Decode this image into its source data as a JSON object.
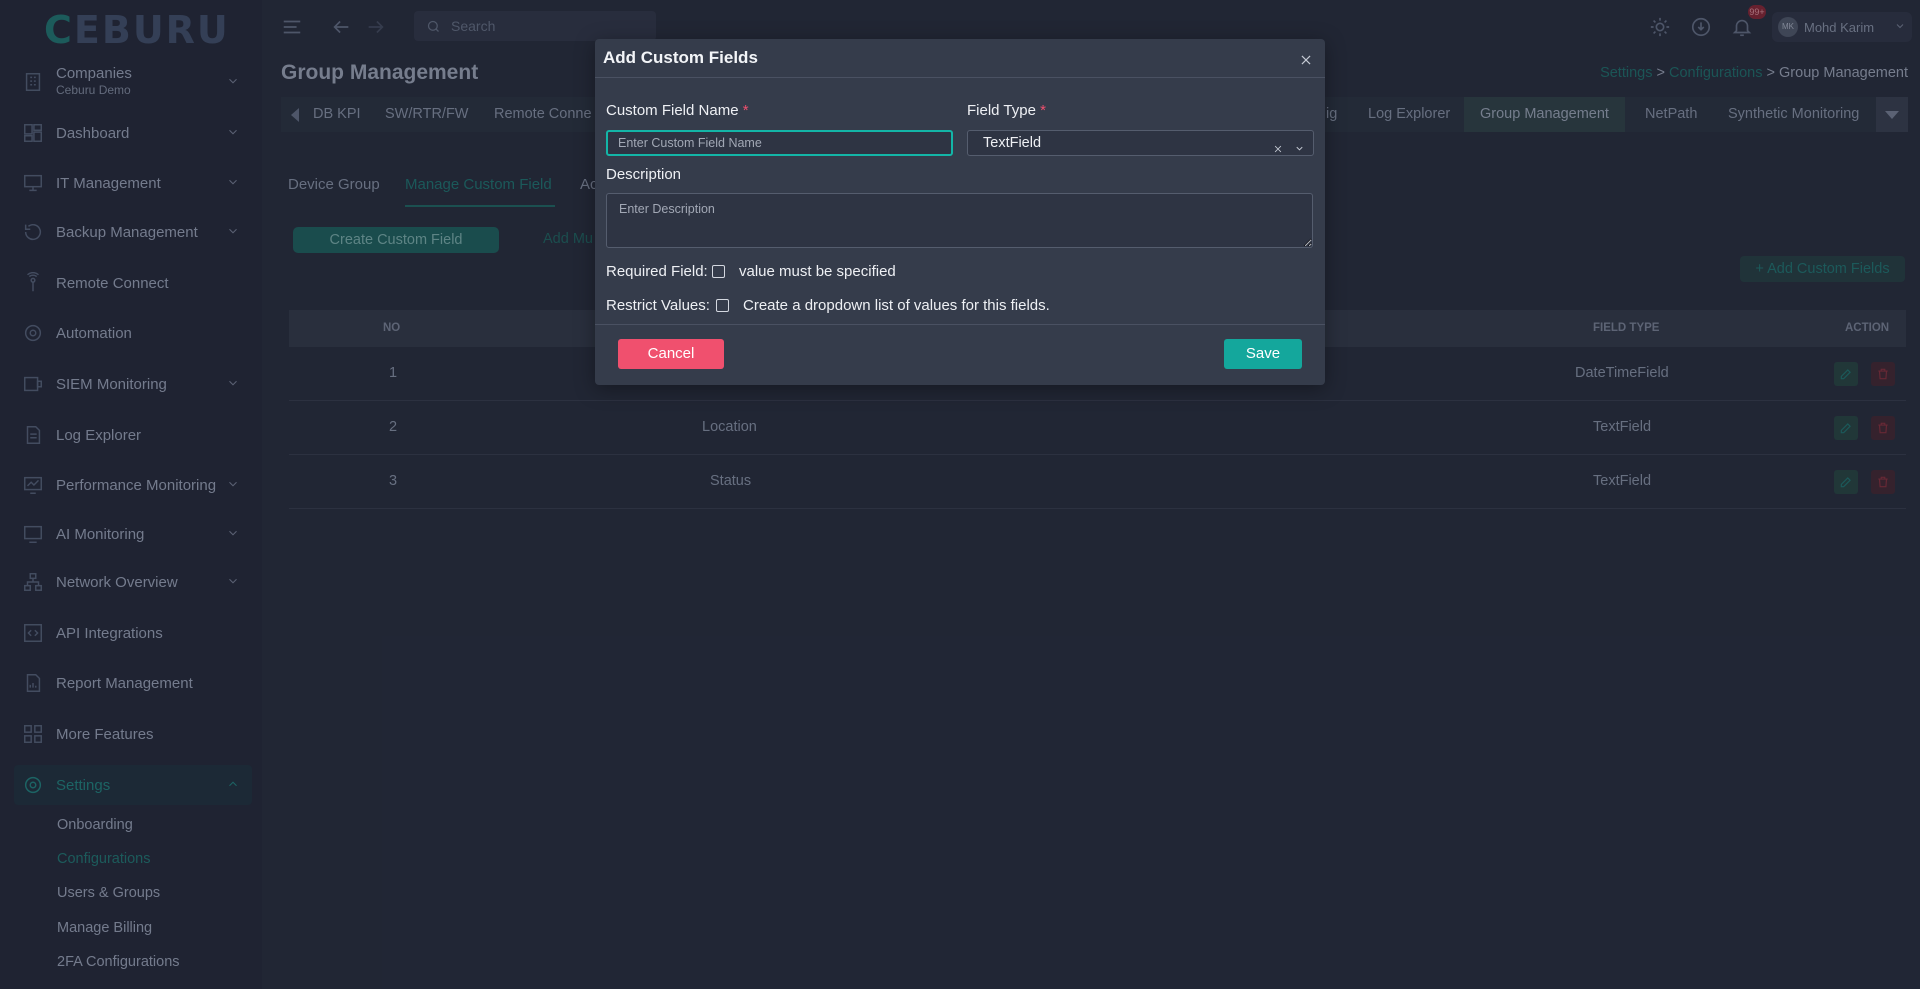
{
  "brand": {
    "logo": "CEBURU"
  },
  "sidebar": {
    "companies": {
      "label": "Companies",
      "sub": "Ceburu Demo"
    },
    "items": [
      {
        "label": "Dashboard"
      },
      {
        "label": "IT Management"
      },
      {
        "label": "Backup Management"
      },
      {
        "label": "Remote Connect"
      },
      {
        "label": "Automation"
      },
      {
        "label": "SIEM Monitoring"
      },
      {
        "label": "Log Explorer"
      },
      {
        "label": "Performance Monitoring"
      },
      {
        "label": "AI Monitoring"
      },
      {
        "label": "Network Overview"
      },
      {
        "label": "API Integrations"
      },
      {
        "label": "Report Management"
      },
      {
        "label": "More Features"
      },
      {
        "label": "Settings"
      }
    ],
    "settings_sub": [
      "Onboarding",
      "Configurations",
      "Users & Groups",
      "Manage Billing",
      "2FA Configurations"
    ]
  },
  "topbar": {
    "search_placeholder": "Search",
    "notifications_badge": "99+",
    "user_initials": "MK",
    "user_name": "Mohd Karim"
  },
  "page": {
    "title": "Group Management",
    "breadcrumb": [
      "Settings",
      "Configurations",
      "Group Management"
    ],
    "separator": ">"
  },
  "tabs": {
    "items": [
      "DB KPI",
      "SW/RTR/FW",
      "Remote Conne",
      "ig",
      "Log Explorer",
      "Group Management",
      "NetPath",
      "Synthetic Monitoring"
    ],
    "active": "Group Management"
  },
  "subtabs": {
    "items": [
      "Device Group",
      "Manage Custom Field",
      "Ac"
    ],
    "active": "Manage Custom Field"
  },
  "actions": {
    "create": "Create Custom Field",
    "add_multi": "Add Mu",
    "add_custom": "+ Add Custom Fields"
  },
  "table": {
    "headers": {
      "no": "NO",
      "field_type": "FIELD TYPE",
      "action": "ACTION"
    },
    "rows": [
      {
        "no": "1",
        "name": "",
        "type": "DateTimeField"
      },
      {
        "no": "2",
        "name": "Location",
        "type": "TextField"
      },
      {
        "no": "3",
        "name": "Status",
        "type": "TextField"
      }
    ]
  },
  "modal": {
    "title": "Add Custom Fields",
    "name_label": "Custom Field Name",
    "name_placeholder": "Enter Custom Field Name",
    "type_label": "Field Type",
    "type_value": "TextField",
    "required_mark": "*",
    "description_label": "Description",
    "description_placeholder": "Enter Description",
    "required_label": "Required Field:",
    "required_hint": "value must be specified",
    "restrict_label": "Restrict Values:",
    "restrict_hint": "Create a dropdown list of values for this fields.",
    "cancel": "Cancel",
    "save": "Save"
  },
  "colors": {
    "accent": "#14a79c",
    "danger": "#f0506e",
    "modal_bg": "#353c4b",
    "page_bg": "#252b3a"
  }
}
